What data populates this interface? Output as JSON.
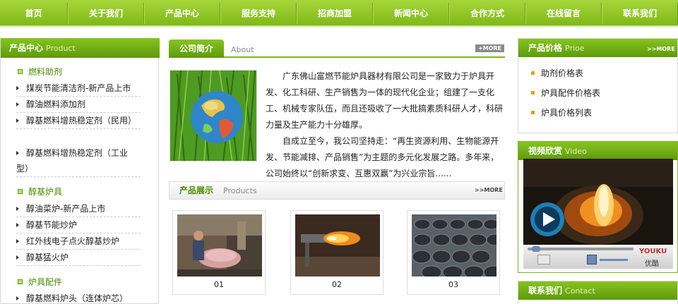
{
  "nav": {
    "items": [
      "首页",
      "关于我们",
      "产品中心",
      "服务支持",
      "招商加盟",
      "新闻中心",
      "合作方式",
      "在线留言",
      "联系我们"
    ]
  },
  "left_panel": {
    "title": "产品中心",
    "title_en": "Product",
    "categories": [
      {
        "label": "燃料助剂",
        "items": [
          "煤炭节能清洁剂-新产品上市",
          "醇油燃料添加剂",
          "醇基燃料增热稳定剂（民用）",
          "醇基燃料增热稳定剂（工业型）"
        ]
      },
      {
        "label": "醇基炉具",
        "items": [
          "醇油菜炉-新产品上市",
          "醇基节能炒炉",
          "红外线电子点火醇基炒炉",
          "醇基猛火炉"
        ]
      },
      {
        "label": "炉具配件",
        "items": [
          "醇基燃料炉头（连体炉芯）"
        ]
      }
    ]
  },
  "about": {
    "tab_label": "公司简介",
    "tab_en": "About",
    "more": "+MORE",
    "paragraph_1": "广东佛山富燃节能炉具器材有限公司是一家致力于炉具开发、化工科研、生产销售为一体的现代化企业；组建了一支化工、机械专家队伍，而且还吸收了一大批搞素质科研人才，科研力量及生产能力十分雄厚。",
    "paragraph_2": "自成立至今，我公司坚持走：“再生资源利用、生物能源开发、节能减排、产品销售”为主题的多元化发展之路。多年来，公司始终以“创新求变、互惠双赢”为兴业宗旨......"
  },
  "products": {
    "title": "产品展示",
    "title_en": "Products",
    "more": ">>MORE",
    "items": [
      {
        "caption": "01"
      },
      {
        "caption": "02"
      },
      {
        "caption": "03"
      }
    ]
  },
  "price": {
    "title": "产品价格",
    "title_en": "Prioe",
    "more": ">>MORE",
    "items": [
      "助剂价格表",
      "炉具配件价格表",
      "炉具价格列表"
    ]
  },
  "video": {
    "title": "视频欣赏",
    "title_en": "Video",
    "brand": "YOUKU",
    "brand_cn": "优酷"
  },
  "contact": {
    "title": "联系我们",
    "title_en": "Contact"
  },
  "colors": {
    "accent": "#7fb819",
    "accent_dark": "#5f9a0c",
    "category_text": "#4a8a00",
    "bullet": "#e8a000"
  }
}
